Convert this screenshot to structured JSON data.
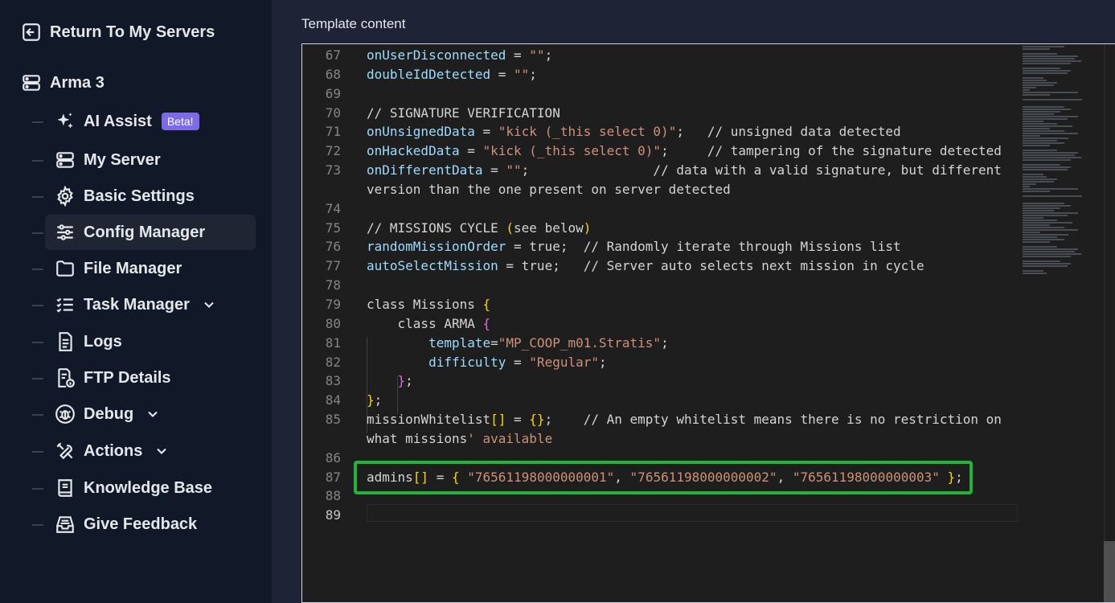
{
  "sidebar": {
    "return_label": "Return To My Servers",
    "server_name": "Arma 3",
    "items": [
      {
        "label": "AI Assist",
        "badge": "Beta!",
        "icon": "sparkles-icon"
      },
      {
        "label": "My Server",
        "icon": "server-icon"
      },
      {
        "label": "Basic Settings",
        "icon": "gear-icon"
      },
      {
        "label": "Config Manager",
        "icon": "sliders-icon"
      },
      {
        "label": "File Manager",
        "icon": "folder-icon"
      },
      {
        "label": "Task Manager",
        "icon": "tasklist-icon"
      },
      {
        "label": "Logs",
        "icon": "document-icon"
      },
      {
        "label": "FTP Details",
        "icon": "file-info-icon"
      },
      {
        "label": "Debug",
        "icon": "bug-icon"
      },
      {
        "label": "Actions",
        "icon": "tools-icon"
      },
      {
        "label": "Knowledge Base",
        "icon": "book-icon"
      },
      {
        "label": "Give Feedback",
        "icon": "inbox-icon"
      }
    ]
  },
  "main": {
    "title": "Template content"
  },
  "editor": {
    "line_numbers": [
      "67",
      "68",
      "69",
      "70",
      "71",
      "72",
      "73",
      "",
      "74",
      "75",
      "76",
      "77",
      "78",
      "79",
      "80",
      "81",
      "82",
      "83",
      "84",
      "85",
      "",
      "86",
      "87",
      "88",
      "89"
    ],
    "lines": {
      "l67a": "onUserDisconnected",
      "l67b": " = ",
      "l67c": "\"\"",
      "l67d": ";",
      "l68a": "doubleIdDetected",
      "l68b": " = ",
      "l68c": "\"\"",
      "l68d": ";",
      "l70": "// SIGNATURE VERIFICATION",
      "l71a": "onUnsignedData",
      "l71b": " = ",
      "l71c": "\"kick (_this select 0)\"",
      "l71d": ";   // unsigned data detected",
      "l72a": "onHackedData",
      "l72b": " = ",
      "l72c": "\"kick (_this select 0)\"",
      "l72d": ";     // tampering of the signature detected",
      "l73a": "onDifferentData",
      "l73b": " = ",
      "l73c": "\"\"",
      "l73d": ";                // data with a valid signature, but different",
      "l73w": "version than the one present on server detected",
      "l75a": "// MISSIONS CYCLE ",
      "l75b": "(",
      "l75c": "see below",
      "l75d": ")",
      "l76a": "randomMissionOrder",
      "l76b": " = true;  // Randomly iterate through Missions list",
      "l77a": "autoSelectMission",
      "l77b": " = true;   // Server auto selects next mission in cycle",
      "l79a": "class Missions ",
      "l79b": "{",
      "l80a": "    class ARMA ",
      "l80b": "{",
      "l81a": "template",
      "l81b": "=",
      "l81c": "\"MP_COOP_m01.Stratis\"",
      "l81d": ";",
      "l82a": "difficulty",
      "l82b": " = ",
      "l82c": "\"Regular\"",
      "l82d": ";",
      "l83a": "}",
      "l83b": ";",
      "l84a": "}",
      "l84b": ";",
      "l85a": "missionWhitelist",
      "l85b": "[]",
      "l85c": " = ",
      "l85d": "{}",
      "l85e": ";    // An empty whitelist means there is no restriction on",
      "l85wa": "what missions",
      "l85wb": "' available",
      "l87a": "admins",
      "l87b": "[]",
      "l87c": " = ",
      "l87d": "{",
      "l87e": " ",
      "l87f": "\"76561198000000001\"",
      "l87g": ", ",
      "l87h": "\"76561198000000002\"",
      "l87i": ", ",
      "l87j": "\"76561198000000003\"",
      "l87k": " ",
      "l87l": "}",
      "l87m": ";"
    }
  },
  "colors": {
    "highlight_border": "#22b33c",
    "beta_badge": "#7c6ae8"
  }
}
